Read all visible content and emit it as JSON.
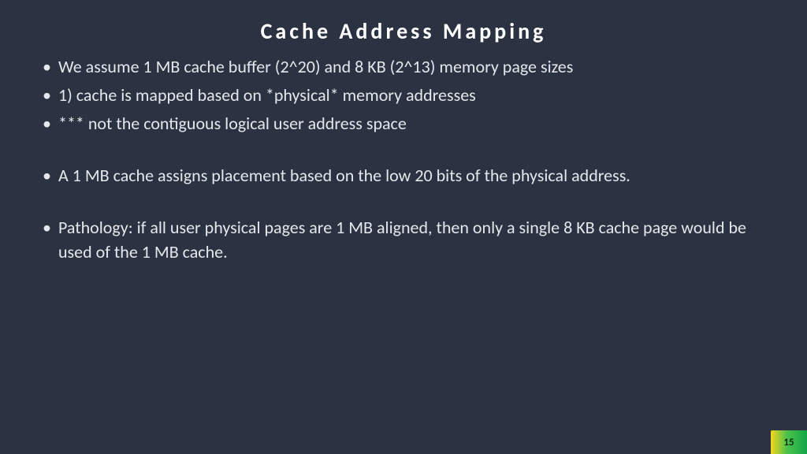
{
  "slide": {
    "title": "Cache Address Mapping",
    "bullets": [
      "We assume 1 MB cache buffer (2^20) and 8 KB (2^13) memory page sizes",
      "1) cache is mapped based on *physical* memory addresses",
      " *** not the contiguous logical user address space",
      "",
      "A 1 MB cache assigns placement based on the low 20 bits of the physical address.",
      "",
      "Pathology:  if all user physical pages are 1 MB aligned, then only a single 8 KB cache page would be used of the 1 MB cache."
    ],
    "page_number": "15"
  }
}
